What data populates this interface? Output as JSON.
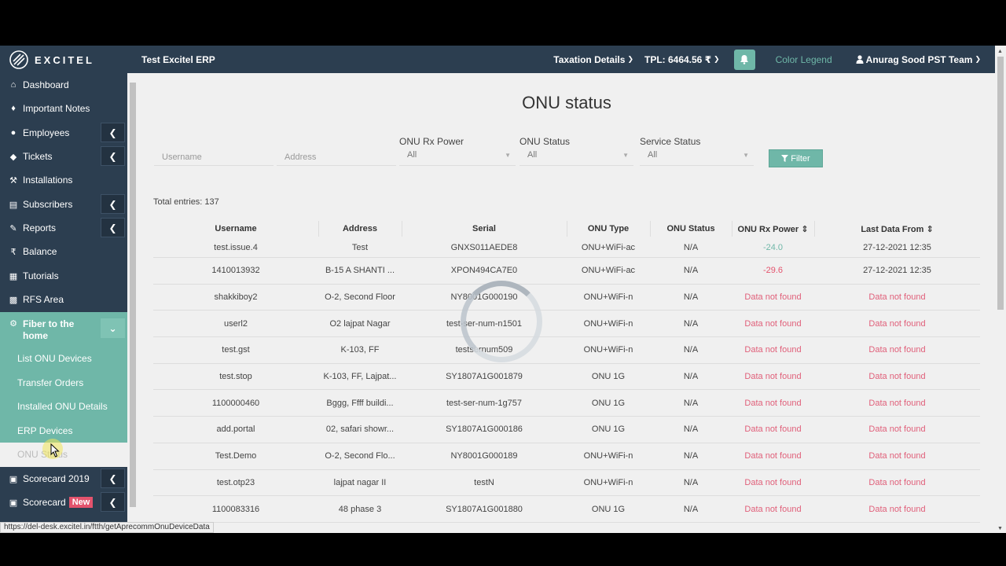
{
  "header": {
    "brand": "EXCITEL",
    "app_title": "Test Excitel ERP",
    "taxation": "Taxation Details",
    "tpl": "TPL: 6464.56 ₹",
    "color_legend": "Color Legend",
    "user": "Anurag Sood PST Team"
  },
  "sidebar": {
    "items": [
      {
        "label": "Dashboard",
        "icon": "home-icon"
      },
      {
        "label": "Important Notes",
        "icon": "bell-icon"
      },
      {
        "label": "Employees",
        "icon": "user-circle-icon"
      },
      {
        "label": "Tickets",
        "icon": "ticket-icon"
      },
      {
        "label": "Installations",
        "icon": "wrench-icon"
      },
      {
        "label": "Subscribers",
        "icon": "id-card-icon"
      },
      {
        "label": "Reports",
        "icon": "report-icon"
      },
      {
        "label": "Balance",
        "icon": "rupee-icon"
      },
      {
        "label": "Tutorials",
        "icon": "book-icon"
      },
      {
        "label": "RFS Area",
        "icon": "building-icon"
      },
      {
        "label": "Fiber to the home",
        "icon": "gear-icon"
      }
    ],
    "sub_items": [
      "List ONU Devices",
      "Transfer Orders",
      "Installed ONU Details",
      "ERP Devices",
      "ONU Status"
    ],
    "bottom_items": [
      {
        "label": "Scorecard 2019",
        "icon": "scorecard-icon"
      },
      {
        "label": "Scorecard",
        "icon": "scorecard-icon",
        "badge": "New"
      }
    ]
  },
  "page": {
    "title": "ONU status",
    "filters": {
      "username_placeholder": "Username",
      "address_placeholder": "Address",
      "rx_power_label": "ONU Rx Power",
      "rx_power_value": "All",
      "onu_status_label": "ONU Status",
      "onu_status_value": "All",
      "service_status_label": "Service Status",
      "service_status_value": "All",
      "filter_button": "Filter"
    },
    "total_entries": "Total entries: 137"
  },
  "table": {
    "columns": [
      "Username",
      "Address",
      "Serial",
      "ONU Type",
      "ONU Status",
      "ONU Rx Power",
      "Last Data From"
    ],
    "rows": [
      [
        "test.issue.4",
        "Test",
        "GNXS011AEDE8",
        "ONU+WiFi-ac",
        "N/A",
        "-24.0",
        "27-12-2021 12:35"
      ],
      [
        "1410013932",
        "B-15 A SHANTI ...",
        "XPON494CA7E0",
        "ONU+WiFi-ac",
        "N/A",
        "-29.6",
        "27-12-2021 12:35"
      ],
      [
        "shakkiboy2",
        "O-2, Second Floor",
        "NY8001G000190",
        "ONU+WiFi-n",
        "N/A",
        "Data not found",
        "Data not found"
      ],
      [
        "userl2",
        "O2 lajpat Nagar",
        "test-ser-num-n1501",
        "ONU+WiFi-n",
        "N/A",
        "Data not found",
        "Data not found"
      ],
      [
        "test.gst",
        "K-103, FF",
        "testsernum509",
        "ONU+WiFi-n",
        "N/A",
        "Data not found",
        "Data not found"
      ],
      [
        "test.stop",
        "K-103, FF, Lajpat...",
        "SY1807A1G001879",
        "ONU 1G",
        "N/A",
        "Data not found",
        "Data not found"
      ],
      [
        "1100000460",
        "Bggg, Ffff buildi...",
        "test-ser-num-1g757",
        "ONU 1G",
        "N/A",
        "Data not found",
        "Data not found"
      ],
      [
        "add.portal",
        "02, safari showr...",
        "SY1807A1G000186",
        "ONU 1G",
        "N/A",
        "Data not found",
        "Data not found"
      ],
      [
        "Test.Demo",
        "O-2, Second Flo...",
        "NY8001G000189",
        "ONU+WiFi-n",
        "N/A",
        "Data not found",
        "Data not found"
      ],
      [
        "test.otp23",
        "lajpat nagar II",
        "testN",
        "ONU+WiFi-n",
        "N/A",
        "Data not found",
        "Data not found"
      ],
      [
        "1100083316",
        "48 phase 3",
        "SY1807A1G001880",
        "ONU 1G",
        "N/A",
        "Data not found",
        "Data not found"
      ]
    ]
  },
  "status_bar_url": "https://del-desk.excitel.in/ftth/getAprecommOnuDeviceData",
  "colors": {
    "topbar": "#2c3e50",
    "accent": "#6fb7a8",
    "danger": "#e4536d"
  }
}
